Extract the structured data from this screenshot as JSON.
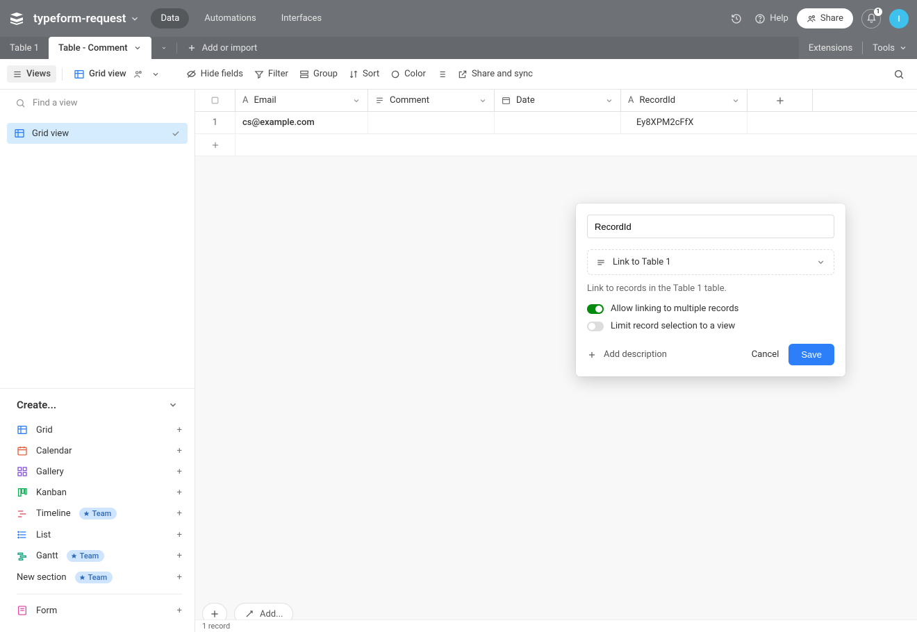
{
  "header": {
    "base_name": "typeform-request",
    "nav": {
      "data": "Data",
      "automations": "Automations",
      "interfaces": "Interfaces"
    },
    "help": "Help",
    "share": "Share",
    "bell_count": "1",
    "avatar_initial": "I"
  },
  "tabs": {
    "table1": "Table 1",
    "table_comment": "Table - Comment",
    "add_or_import": "Add or import",
    "extensions": "Extensions",
    "tools": "Tools"
  },
  "toolbar": {
    "views": "Views",
    "grid_view": "Grid view",
    "hide_fields": "Hide fields",
    "filter": "Filter",
    "group": "Group",
    "sort": "Sort",
    "color": "Color",
    "share_sync": "Share and sync"
  },
  "sidebar": {
    "find_placeholder": "Find a view",
    "grid_view": "Grid view",
    "create_label": "Create...",
    "items": {
      "grid": "Grid",
      "calendar": "Calendar",
      "gallery": "Gallery",
      "kanban": "Kanban",
      "timeline": "Timeline",
      "list": "List",
      "gantt": "Gantt",
      "new_section": "New section",
      "form": "Form"
    },
    "team_badge": "Team"
  },
  "grid": {
    "columns": {
      "email": "Email",
      "comment": "Comment",
      "date": "Date",
      "recordid": "RecordId"
    },
    "rows": [
      {
        "num": "1",
        "email": "cs@example.com",
        "comment": "",
        "date": "",
        "recordid": "Ey8XPM2cFfX"
      }
    ],
    "add_label": "Add...",
    "record_count": "1 record"
  },
  "popover": {
    "field_name": "RecordId",
    "link_label": "Link to Table 1",
    "hint": "Link to records in the Table 1 table.",
    "allow_multi": "Allow linking to multiple records",
    "limit_view": "Limit record selection to a view",
    "add_desc": "Add description",
    "cancel": "Cancel",
    "save": "Save"
  }
}
